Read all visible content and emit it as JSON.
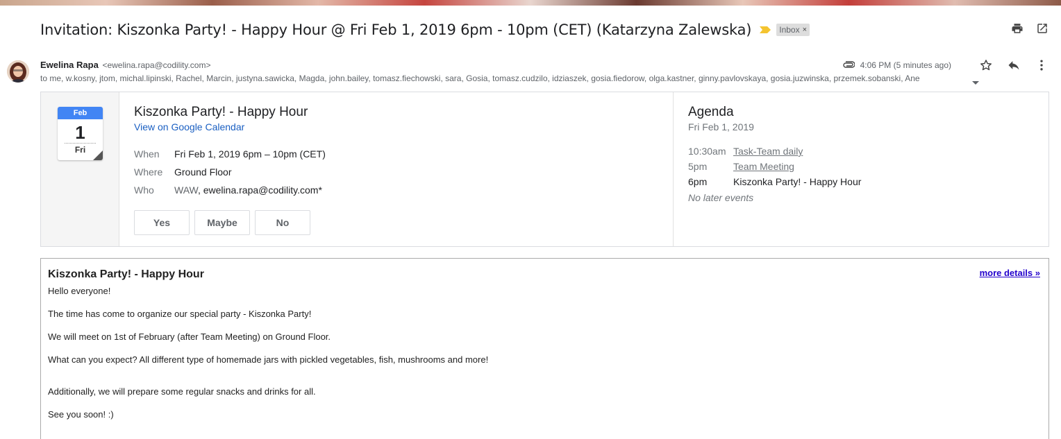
{
  "subject": "Invitation: Kiszonka Party! - Happy Hour @ Fri Feb 1, 2019 6pm - 10pm (CET) (Katarzyna Zalewska)",
  "label": {
    "text": "Inbox",
    "remove": "×"
  },
  "importance_color": "#f4c430",
  "sender": {
    "name": "Ewelina Rapa",
    "email": "<ewelina.rapa@codility.com>"
  },
  "timestamp": "4:06 PM (5 minutes ago)",
  "recipients": "to me, w.kosny, jtom, michal.lipinski, Rachel, Marcin, justyna.sawicka, Magda, john.bailey, tomasz.fiechowski, sara, Gosia, tomasz.cudzilo, idziaszek, gosia.fiedorow, olga.kastner, ginny.pavlovskaya, gosia.juzwinska, przemek.sobanski, Ane",
  "icons": {
    "print": "print-icon",
    "open_new_window": "open-in-new-window-icon",
    "attachment": "attachment-icon",
    "star": "star-icon",
    "reply": "reply-icon",
    "more": "more-vert-icon",
    "expand_recipients": "caret-down-icon"
  },
  "calendar": {
    "month": "Feb",
    "day": "1",
    "weekday": "Fri",
    "event_title": "Kiszonka Party! - Happy Hour",
    "view_link": "View on Google Calendar",
    "details": {
      "when_label": "When",
      "when_value": "Fri Feb 1, 2019 6pm – 10pm (CET)",
      "where_label": "Where",
      "where_value": "Ground Floor",
      "who_label": "Who",
      "who_prefix": "WAW",
      "who_value": "ewelina.rapa@codility.com*"
    },
    "rsvp": {
      "yes": "Yes",
      "maybe": "Maybe",
      "no": "No"
    },
    "accent_color": "#4285f4"
  },
  "agenda": {
    "title": "Agenda",
    "date": "Fri Feb 1, 2019",
    "events": [
      {
        "time": "10:30am",
        "title": "Task-Team daily"
      },
      {
        "time": "5pm",
        "title": "Team Meeting"
      },
      {
        "time": "6pm",
        "title": "Kiszonka Party! - Happy Hour"
      }
    ],
    "none_text": "No later events"
  },
  "description": {
    "title": "Kiszonka Party! - Happy Hour",
    "more_link": "more details »",
    "paragraphs": [
      "Hello everyone!",
      "The time has come to organize our special party - Kiszonka Party!",
      "We will meet on 1st of February (after Team Meeting) on Ground Floor.",
      "What can you expect? All different type of homemade jars with pickled vegetables, fish, mushrooms and more!",
      "Additionally, we will prepare some regular snacks and drinks for all.",
      "See you soon! :)"
    ]
  }
}
